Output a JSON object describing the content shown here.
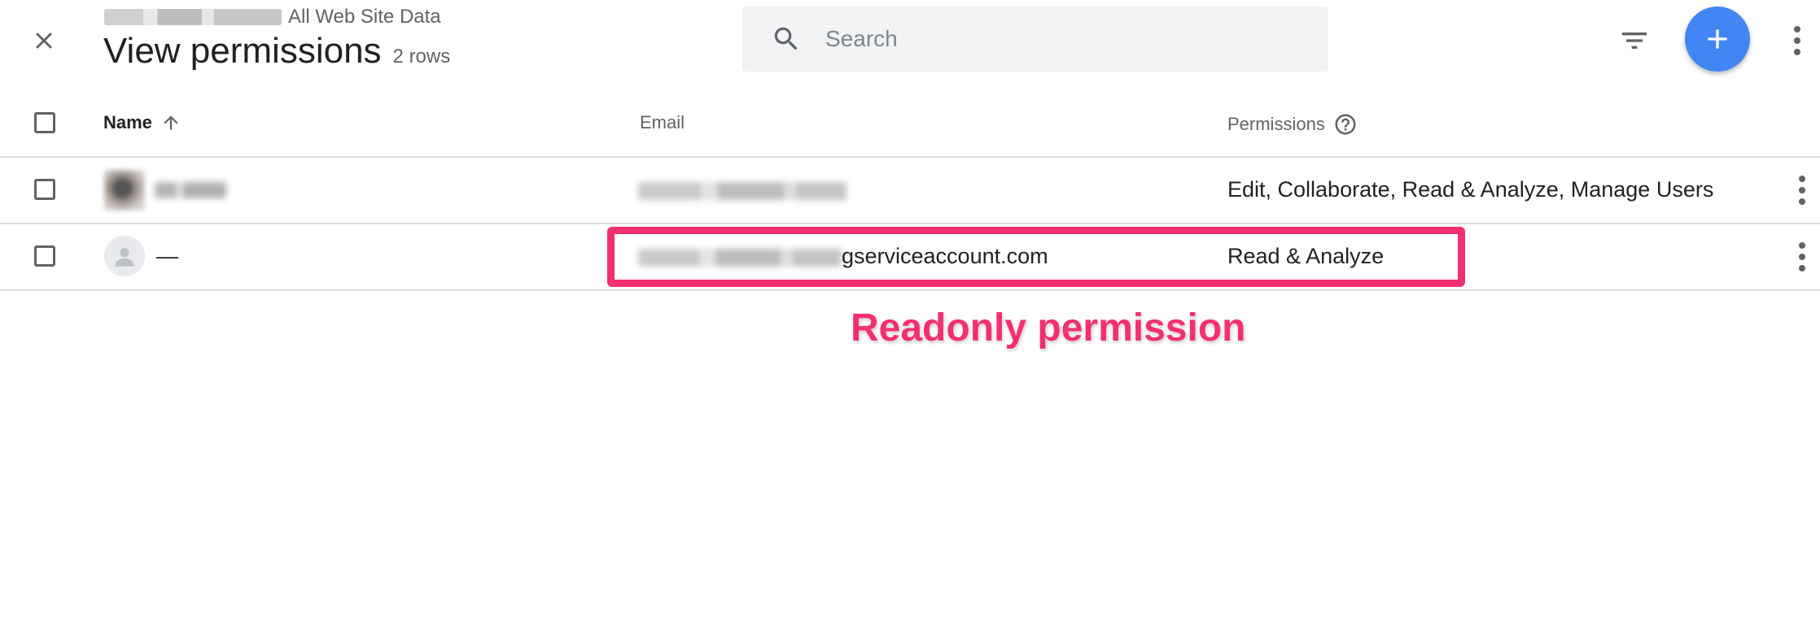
{
  "header": {
    "breadcrumb": "All Web Site Data",
    "title": "View permissions",
    "row_count": "2 rows"
  },
  "search": {
    "placeholder": "Search"
  },
  "table": {
    "columns": {
      "name": "Name",
      "email": "Email",
      "permissions": "Permissions"
    },
    "rows": [
      {
        "name": "",
        "email": "",
        "permissions": "Edit, Collaborate, Read & Analyze, Manage Users"
      },
      {
        "name": "—",
        "email_visible": "gserviceaccount.com",
        "permissions": "Read & Analyze"
      }
    ]
  },
  "annotation": {
    "label": "Readonly permission"
  },
  "colors": {
    "accent": "#4285f4",
    "highlight": "#f3306f"
  },
  "icons": [
    "close-icon",
    "search-icon",
    "filter-icon",
    "add-icon",
    "more-vert-icon",
    "arrow-up-icon",
    "help-circle-icon",
    "person-icon"
  ]
}
